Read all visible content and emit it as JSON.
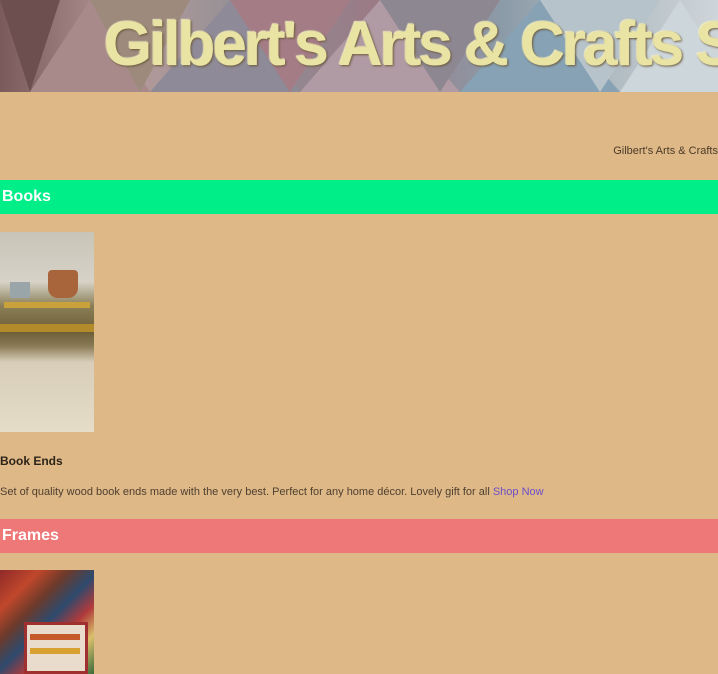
{
  "header": {
    "title": "Gilbert's Arts & Crafts Shop",
    "breadcrumb": "Gilbert's Arts & Crafts"
  },
  "sections": [
    {
      "label": "Books",
      "color": "#00ee88",
      "item": {
        "title": "Book Ends",
        "description": "Set of quality wood book ends made with the very best. Perfect for any home décor. Lovely gift for all",
        "link": "Shop Now"
      }
    },
    {
      "label": "Frames",
      "color": "#ee7777"
    }
  ]
}
